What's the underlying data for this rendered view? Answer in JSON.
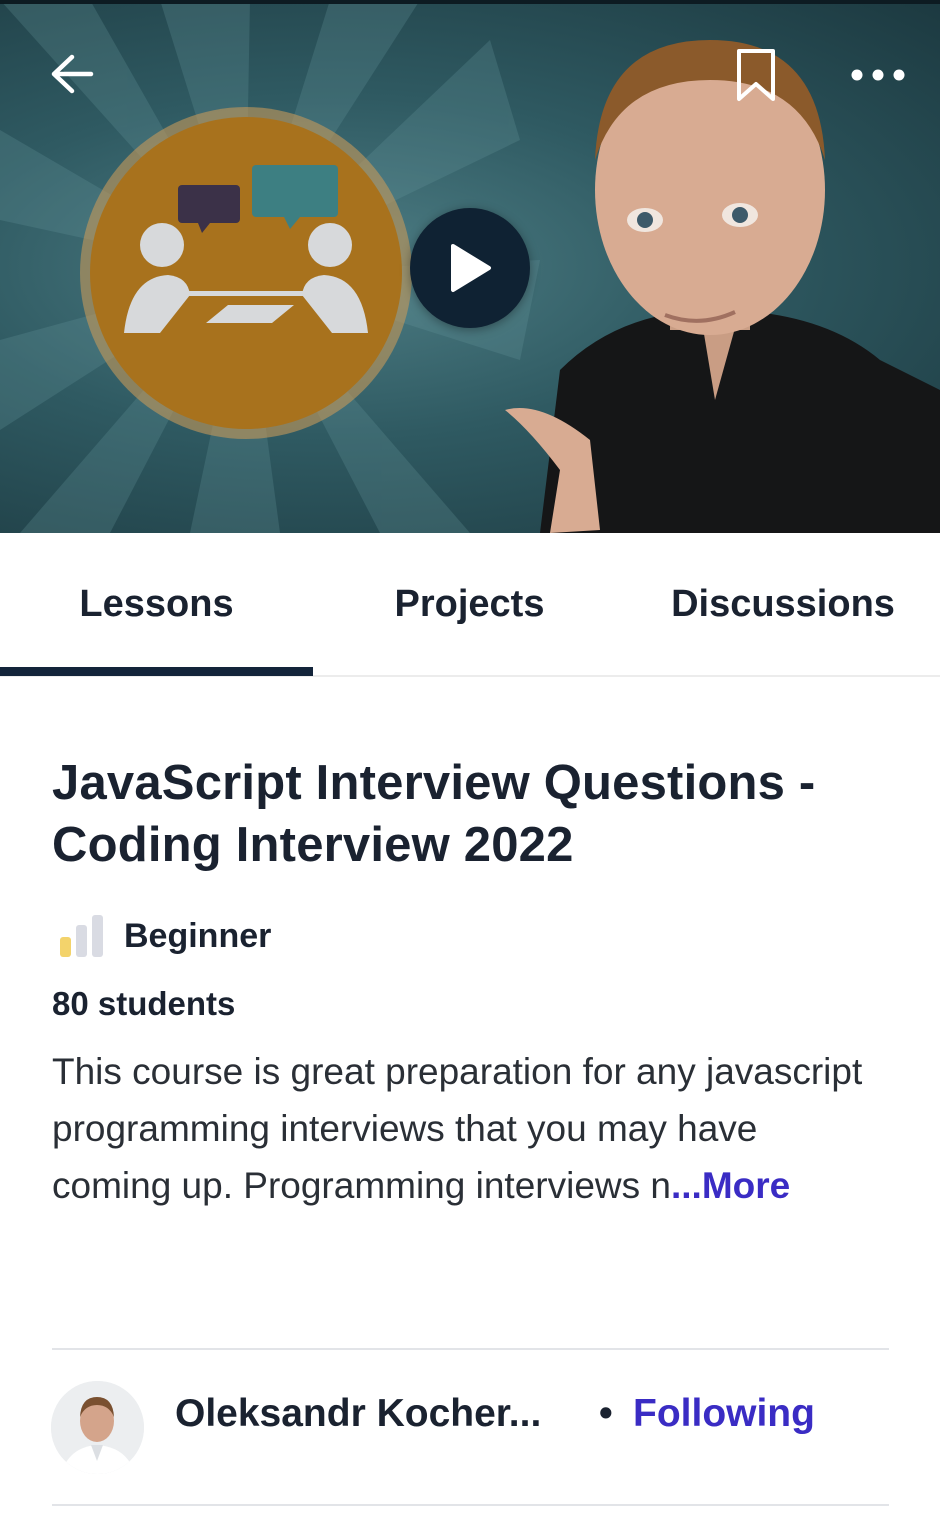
{
  "hero": {
    "icons": {
      "back": "arrow-left-icon",
      "bookmark": "bookmark-icon",
      "more": "more-horizontal-icon",
      "play": "play-icon"
    }
  },
  "tabs": [
    {
      "label": "Lessons",
      "active": true
    },
    {
      "label": "Projects",
      "active": false
    },
    {
      "label": "Discussions",
      "active": false
    }
  ],
  "course": {
    "title": "JavaScript Interview Questions - Coding Interview 2022",
    "level": "Beginner",
    "level_value": 1,
    "level_max": 3,
    "students": "80 students",
    "description": "This course is great preparation for any javascript programming interviews that you may have coming up. Programming interviews n",
    "more_label": "...More"
  },
  "teacher": {
    "name": "Oleksandr Kocher...",
    "separator": "•",
    "follow_label": "Following"
  },
  "colors": {
    "accent": "#3a2cc4",
    "tab_indicator": "#13243a",
    "text": "#1a2230",
    "level_active": "#f3d36b",
    "level_inactive": "#d9dbe3"
  }
}
